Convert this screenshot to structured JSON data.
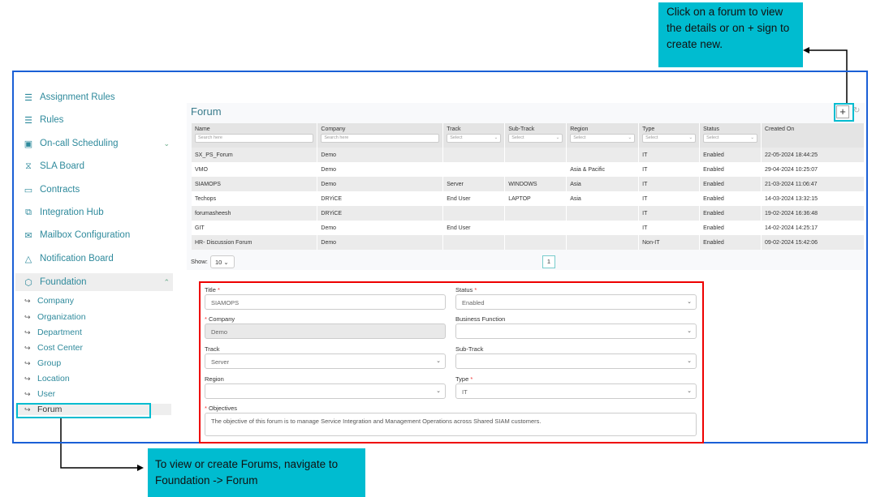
{
  "callouts": {
    "top": "Click on a forum to view the details or on + sign to create new.",
    "bottom": "To  view or create Forums, navigate to Foundation -> Forum"
  },
  "sidebar": {
    "items": [
      {
        "label": "Assignment Rules",
        "icon": "list-icon"
      },
      {
        "label": "Rules",
        "icon": "list-icon"
      },
      {
        "label": "On-call Scheduling",
        "icon": "calendar-clock-icon"
      },
      {
        "label": "SLA Board",
        "icon": "hourglass-icon"
      },
      {
        "label": "Contracts",
        "icon": "laptop-icon"
      },
      {
        "label": "Integration Hub",
        "icon": "copy-icon"
      },
      {
        "label": "Mailbox Configuration",
        "icon": "mail-icon"
      },
      {
        "label": "Notification Board",
        "icon": "bell-icon"
      },
      {
        "label": "Foundation",
        "icon": "cube-icon"
      }
    ],
    "sub": [
      "Company",
      "Organization",
      "Department",
      "Cost Center",
      "Group",
      "Location",
      "User",
      "Forum"
    ]
  },
  "main": {
    "title": "Forum",
    "columns": [
      {
        "label": "Name",
        "filter": "Search here"
      },
      {
        "label": "Company",
        "filter": "Search here"
      },
      {
        "label": "Track",
        "filter": "Select"
      },
      {
        "label": "Sub-Track",
        "filter": "Select"
      },
      {
        "label": "Region",
        "filter": "Select"
      },
      {
        "label": "Type",
        "filter": "Select"
      },
      {
        "label": "Status",
        "filter": "Select"
      },
      {
        "label": "Created On",
        "filter": null
      }
    ],
    "rows": [
      [
        "SX_PS_Forum",
        "Demo",
        "",
        "",
        "",
        "IT",
        "Enabled",
        "22-05-2024 18:44:25"
      ],
      [
        "VMO",
        "Demo",
        "",
        "",
        "Asia & Pacific",
        "IT",
        "Enabled",
        "29-04-2024 10:25:07"
      ],
      [
        "SIAMOPS",
        "Demo",
        "Server",
        "WINDOWS",
        "Asia",
        "IT",
        "Enabled",
        "21-03-2024 11:06:47"
      ],
      [
        "Techops",
        "DRYiCE",
        "End User",
        "LAPTOP",
        "Asia",
        "IT",
        "Enabled",
        "14-03-2024 13:32:15"
      ],
      [
        "forumasheesh",
        "DRYiCE",
        "",
        "",
        "",
        "IT",
        "Enabled",
        "19-02-2024 16:36:48"
      ],
      [
        "GIT",
        "Demo",
        "End User",
        "",
        "",
        "IT",
        "Enabled",
        "14-02-2024 14:25:17"
      ],
      [
        "HR- Discussion Forum",
        "Demo",
        "",
        "",
        "",
        "Non-IT",
        "Enabled",
        "09-02-2024 15:42:06"
      ]
    ],
    "show_label": "Show:",
    "page_size": "10",
    "page": "1",
    "add_label": "+",
    "refresh_label": "↻"
  },
  "form": {
    "title_label": "Title",
    "title_value": "SIAMOPS",
    "status_label": "Status",
    "status_value": "Enabled",
    "company_label": "Company",
    "company_value": "Demo",
    "bf_label": "Business Function",
    "bf_value": "",
    "track_label": "Track",
    "track_value": "Server",
    "subtrack_label": "Sub-Track",
    "subtrack_value": "",
    "region_label": "Region",
    "region_value": "",
    "type_label": "Type",
    "type_value": "IT",
    "objectives_label": "Objectives",
    "objectives_value": "The objective of this forum is to manage Service Integration and Management Operations across Shared SIAM customers.",
    "req": "*"
  }
}
